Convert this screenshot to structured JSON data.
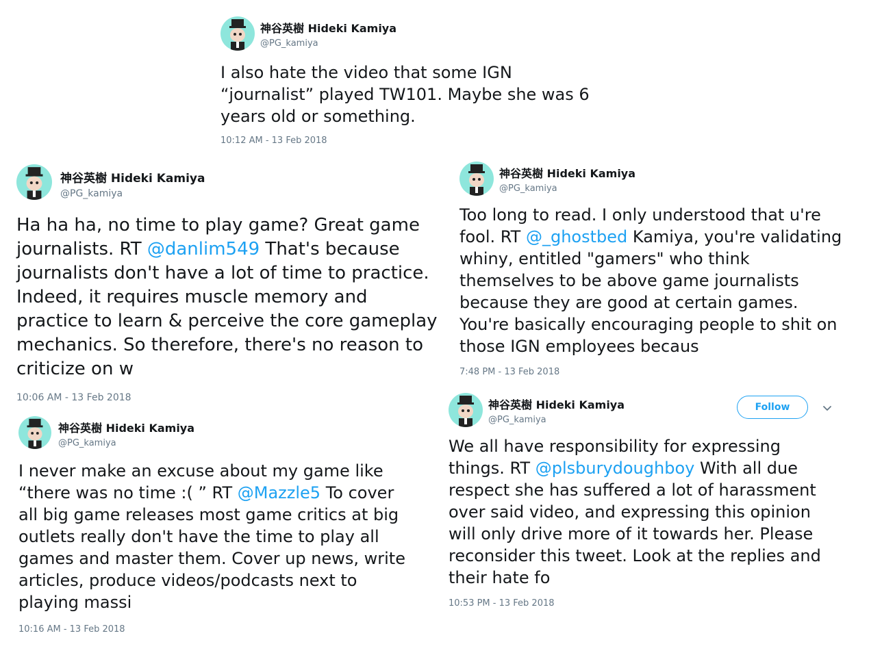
{
  "tweets": [
    {
      "name": "神谷英樹 Hideki Kamiya",
      "handle": "@PG_kamiya",
      "text_before": "I also hate the video that some IGN “journalist” played TW101. Maybe she was 6 years old or something.",
      "mention": "",
      "text_after": "",
      "time": "10:12 AM - 13 Feb 2018"
    },
    {
      "name": "神谷英樹 Hideki Kamiya",
      "handle": "@PG_kamiya",
      "text_before": "Ha ha ha, no time to play game? Great game journalists. RT ",
      "mention": "@danlim549",
      "text_after": " That's because journalists don't have a lot of time to practice. Indeed, it requires muscle memory and practice to learn & perceive the core gameplay mechanics. So therefore, there's no reason to criticize on w",
      "time": "10:06 AM - 13 Feb 2018"
    },
    {
      "name": "神谷英樹 Hideki Kamiya",
      "handle": "@PG_kamiya",
      "text_before": "Too long to read. I only understood that u're fool. RT ",
      "mention": "@_ghostbed",
      "text_after": " Kamiya, you're validating whiny, entitled \"gamers\" who think themselves to be above game journalists because they are good at certain games. You're basically encouraging people to shit on those IGN employees becaus",
      "time": "7:48 PM - 13 Feb 2018"
    },
    {
      "name": "神谷英樹 Hideki Kamiya",
      "handle": "@PG_kamiya",
      "text_before": "I never make an excuse about my game like “there was no time :( ” RT ",
      "mention": "@Mazzle5",
      "text_after": " To cover all big game releases most game critics at big outlets really don't have the time to play all games and master them. Cover up news, write articles, produce videos/podcasts next to playing massi",
      "time": "10:16 AM - 13 Feb 2018"
    },
    {
      "name": "神谷英樹 Hideki Kamiya",
      "handle": "@PG_kamiya",
      "text_before": "We all have responsibility for expressing things. RT ",
      "mention": "@plsburydoughboy",
      "text_after": " With all due respect she has suffered a lot of harassment over said video, and expressing this opinion will only drive more of it towards her. Please reconsider this tweet. Look at the replies and their hate fo",
      "time": "10:53 PM - 13 Feb 2018",
      "follow_label": "Follow"
    }
  ],
  "icons": {
    "avatar": "avatar-icon",
    "chevron": "chevron-down-icon"
  },
  "colors": {
    "link": "#1da1f2",
    "meta": "#657786",
    "avatar_bg": "#8ee6dc"
  }
}
